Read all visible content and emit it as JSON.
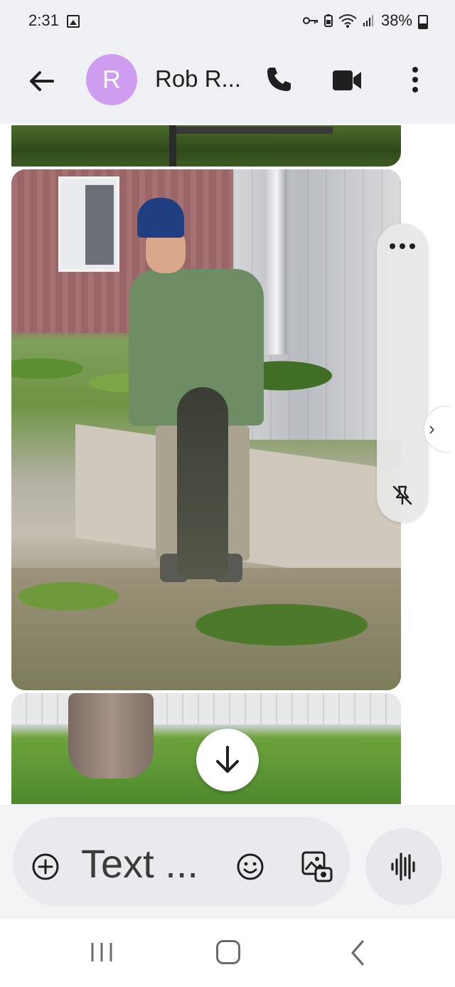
{
  "status_bar": {
    "time": "2:31",
    "battery": "38%"
  },
  "header": {
    "avatar_letter": "R",
    "contact_name": "Rob R...",
    "avatar_color": "#cf9df0"
  },
  "conversation": {
    "attachments": [
      "photo",
      "photo",
      "photo"
    ]
  },
  "composer": {
    "placeholder": "Text ..."
  },
  "icons": {
    "back": "arrow-left-icon",
    "call": "phone-icon",
    "video": "video-camera-icon",
    "more": "more-vertical-icon",
    "scroll_down": "arrow-down-icon",
    "add": "plus-circle-icon",
    "emoji": "emoji-icon",
    "gallery": "gallery-icon",
    "voice": "voice-waveform-icon",
    "unpin": "unpin-icon",
    "options": "more-horizontal-icon",
    "next": "chevron-right-icon"
  }
}
